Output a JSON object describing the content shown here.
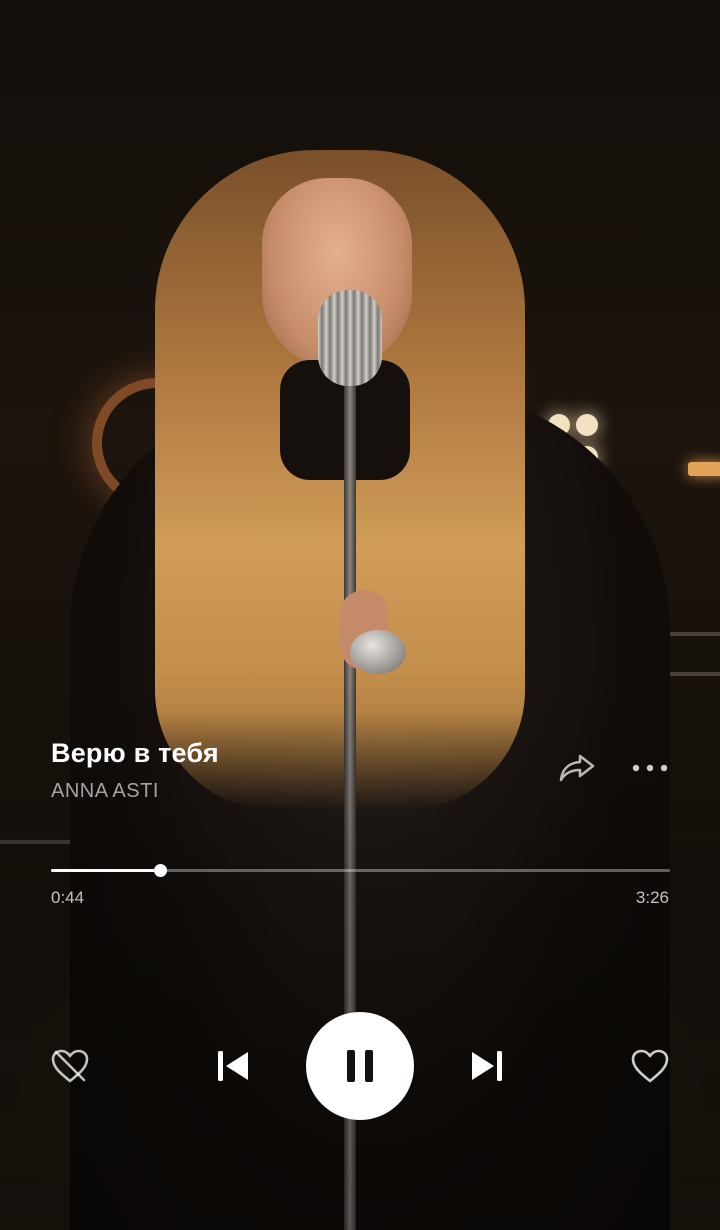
{
  "track": {
    "title": "Верю в тебя",
    "artist": "ANNA ASTI"
  },
  "playback": {
    "current_time": "0:44",
    "total_time": "3:26",
    "progress_fraction": 0.176,
    "state": "playing"
  },
  "icons": {
    "share": "share-arrow-icon",
    "more": "more-dots-icon",
    "dislike": "broken-heart-icon",
    "previous": "skip-previous-icon",
    "pause": "pause-icon",
    "next": "skip-next-icon",
    "like": "heart-icon"
  },
  "colors": {
    "text_primary": "#ffffff",
    "text_secondary": "#a8a4a0",
    "play_button_bg": "#ffffff",
    "play_icon": "#111111"
  }
}
